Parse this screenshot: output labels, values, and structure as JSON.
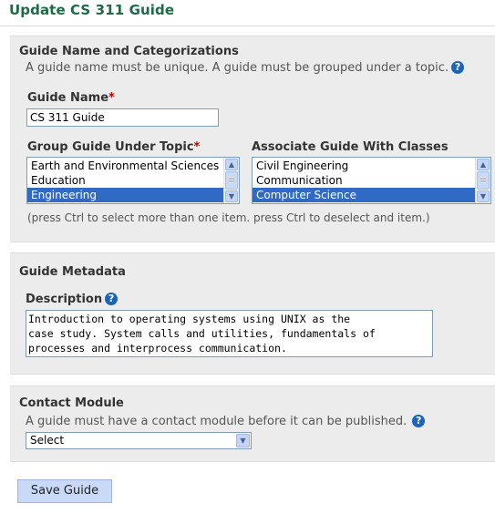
{
  "page": {
    "title": "Update CS 311 Guide"
  },
  "section_name": {
    "heading": "Guide Name and Categorizations",
    "help_text": "A guide name must be unique. A guide must be grouped under a topic.",
    "help_icon": "question-circle-icon",
    "guide_name_label": "Guide Name",
    "guide_name_value": "CS 311 Guide",
    "topic_label": "Group Guide Under Topic",
    "topics": [
      "Earth and Environmental Sciences",
      "Education",
      "Engineering"
    ],
    "topic_selected": "Engineering",
    "classes_label": "Associate Guide With Classes",
    "classes": [
      "Civil Engineering",
      "Communication",
      "Computer Science"
    ],
    "class_selected": "Computer Science",
    "multiselect_hint": "(press Ctrl to select more than one item. press Ctrl to deselect and item.)",
    "required_marker": "*"
  },
  "section_metadata": {
    "heading": "Guide Metadata",
    "description_label": "Description",
    "description_value": "Introduction to operating systems using UNIX as the\ncase study. System calls and utilities, fundamentals of\nprocesses and interprocess communication."
  },
  "section_contact": {
    "heading": "Contact Module",
    "help_text": "A guide must have a contact module before it can be published.",
    "select_value": "Select"
  },
  "actions": {
    "save_label": "Save Guide"
  },
  "colors": {
    "title_green": "#1c6a47",
    "panel_bg": "#ececec",
    "selection_blue": "#316ac5",
    "help_blue": "#1d64b8",
    "required_red": "#c00000"
  }
}
